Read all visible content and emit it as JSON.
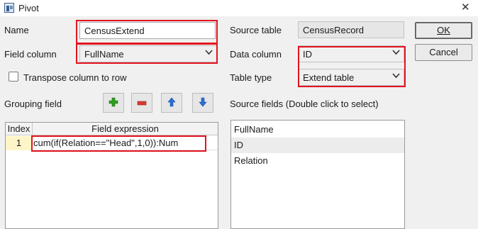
{
  "window": {
    "title": "Pivot",
    "icon": "pivot-app-icon",
    "close_glyph": "✕"
  },
  "left": {
    "name_label": "Name",
    "name_value": "CensusExtend",
    "field_column_label": "Field column",
    "field_column_value": "FullName",
    "transpose_label": "Transpose column to row",
    "transpose_checked": false,
    "grouping_label": "Grouping field",
    "toolbar": [
      {
        "icon": "add-icon",
        "glyph": "+"
      },
      {
        "icon": "remove-icon",
        "glyph": "−"
      },
      {
        "icon": "move-up-icon",
        "glyph": "⬆"
      },
      {
        "icon": "move-down-icon",
        "glyph": "⬇"
      }
    ],
    "grid": {
      "headers": [
        "Index",
        "Field expression"
      ],
      "rows": [
        {
          "index": "1",
          "expression": "cum(if(Relation==\"Head\",1,0)):Num"
        }
      ]
    }
  },
  "right": {
    "source_table_label": "Source table",
    "source_table_value": "CensusRecord",
    "data_column_label": "Data column",
    "data_column_value": "ID",
    "table_type_label": "Table type",
    "table_type_value": "Extend table",
    "source_fields_label": "Source fields (Double click to select)",
    "source_fields": [
      "FullName",
      "ID",
      "Relation"
    ],
    "selected_field": "ID"
  },
  "buttons": {
    "ok": "OK",
    "cancel": "Cancel"
  },
  "colors": {
    "highlight": "#e3141f",
    "index_cell": "#fff4c7",
    "add": "#2e9e1f",
    "remove": "#d83a2e",
    "arrow": "#2a6fd6"
  }
}
